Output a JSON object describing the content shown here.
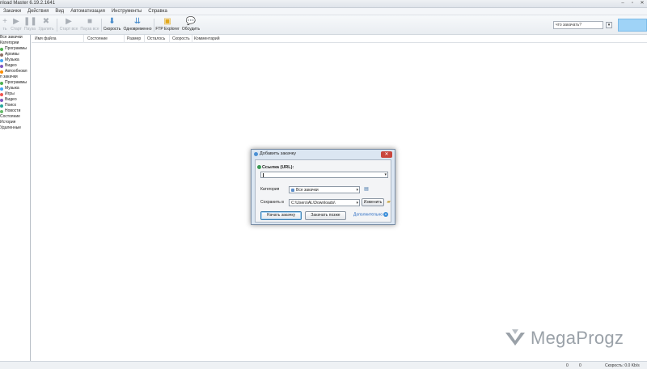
{
  "window": {
    "title": "nload Master 6.19.2.1641"
  },
  "menu": [
    "Закачки",
    "Действия",
    "Вид",
    "Автоматизация",
    "Инструменты",
    "Справка"
  ],
  "toolbar": {
    "items": [
      {
        "label": "ть",
        "icon": "add-icon",
        "enabled": false
      },
      {
        "label": "Старт",
        "icon": "play-icon",
        "enabled": false
      },
      {
        "label": "Пауза",
        "icon": "pause-icon",
        "enabled": false
      },
      {
        "label": "Удалить",
        "icon": "delete-icon",
        "enabled": false
      },
      {
        "label": "Старт все",
        "icon": "play-all-icon",
        "enabled": false
      },
      {
        "label": "Пауза все",
        "icon": "pause-all-icon",
        "enabled": false
      },
      {
        "label": "Скорость",
        "icon": "speed-icon",
        "enabled": true
      },
      {
        "label": "Одновременно",
        "icon": "simultaneous-icon",
        "enabled": true,
        "badge": "1"
      },
      {
        "label": "FTP Explorer",
        "icon": "ftp-explorer-icon",
        "enabled": true
      },
      {
        "label": "Обсудить",
        "icon": "discuss-icon",
        "enabled": true
      }
    ],
    "search_placeholder": "что закачать?",
    "search_button": "▾"
  },
  "sidebar": {
    "items": [
      {
        "label": "Все закачки",
        "color": ""
      },
      {
        "label": "Категории",
        "color": ""
      },
      {
        "label": "Программы",
        "color": "#4caf50"
      },
      {
        "label": "Архивы",
        "color": "#8d6e63"
      },
      {
        "label": "Музыка",
        "color": "#42a5f5"
      },
      {
        "label": "Видео",
        "color": "#7e57c2"
      },
      {
        "label": "Автообновл",
        "color": "#fb8c00"
      },
      {
        "label": "п закачки",
        "color": ""
      },
      {
        "label": "Программы",
        "color": "#4caf50"
      },
      {
        "label": "Музыка",
        "color": "#42a5f5"
      },
      {
        "label": "Игры",
        "color": "#ef5350"
      },
      {
        "label": "Видео",
        "color": "#7e57c2"
      },
      {
        "label": "Поиск",
        "color": "#26a69a"
      },
      {
        "label": "Новости",
        "color": "#66bb6a"
      },
      {
        "label": "Состояние",
        "color": ""
      },
      {
        "label": "История",
        "color": ""
      },
      {
        "label": "Удаленные",
        "color": ""
      }
    ]
  },
  "columns": [
    "Имя файла",
    "Состояние",
    "Размер",
    "Осталось",
    "Скорость",
    "Комментарий"
  ],
  "dialog": {
    "title": "Добавить закачку",
    "url_label": "Ссылка (URL):",
    "url_value": "",
    "category_label": "Категория",
    "category_value": "Все закачки",
    "save_label": "Сохранить в",
    "save_path": "C:\\Users\\AL\\Downloads\\",
    "change_button": "Изменить",
    "start_button": "Начать закачку",
    "later_button": "Закачать позже",
    "more_link": "Дополнительно"
  },
  "statusbar": {
    "count1": "0",
    "count2": "0",
    "speed": "Скорость: 0.0 Kb/s"
  },
  "watermark": {
    "text": "MegaProgz"
  }
}
